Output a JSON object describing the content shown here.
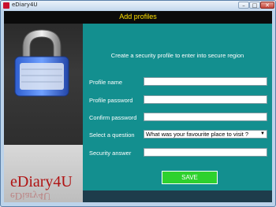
{
  "window": {
    "title": "eDiary4U",
    "controls": {
      "minimize": "–",
      "maximize": "□",
      "close": "✕"
    }
  },
  "header": {
    "title": "Add profiles"
  },
  "sidebar": {
    "brand": "eDiary4U",
    "lock_icon": "padlock-icon"
  },
  "form": {
    "subtitle": "Create a security profile to enter into secure region",
    "profile_name_label": "Profile name",
    "profile_password_label": "Profile password",
    "confirm_password_label": "Confirm password",
    "question_label": "Select a question",
    "question_selected": "What was your favourite place to visit ?",
    "answer_label": "Security answer",
    "profile_name_value": "",
    "profile_password_value": "",
    "confirm_password_value": "",
    "answer_value": "",
    "save_label": "SAVE"
  },
  "colors": {
    "panel": "#138f8f",
    "header": "#0b0b0b",
    "header_text": "#ffe000",
    "save_button": "#2ed12e",
    "brand": "#b01313"
  }
}
